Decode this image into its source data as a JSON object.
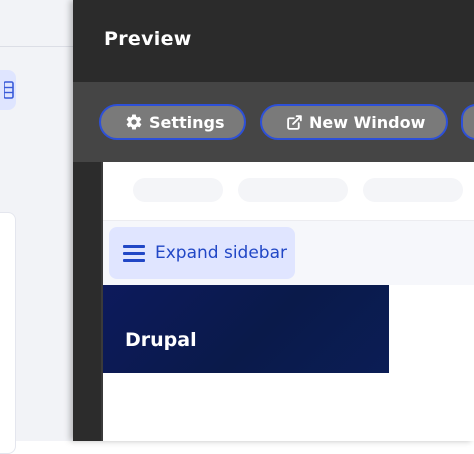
{
  "preview": {
    "title": "Preview",
    "toolbar": {
      "settings_label": "Settings",
      "new_window_label": "New Window"
    }
  },
  "site": {
    "expand_sidebar_label": "Expand sidebar",
    "brand_name": "Drupal"
  },
  "icons": {
    "settings": "gear-icon",
    "new_window": "external-link-icon",
    "expand_sidebar": "hamburger-menu-icon",
    "background_app": "table-icon"
  },
  "colors": {
    "accent_border": "#2d50d8",
    "button_fill": "#7a7a7a",
    "panel_header": "#2b2b2b",
    "toolbar": "#454545",
    "expand_button_bg": "#e0e5ff",
    "expand_button_text": "#2147c6",
    "brand_block": "#0d1a5c"
  }
}
